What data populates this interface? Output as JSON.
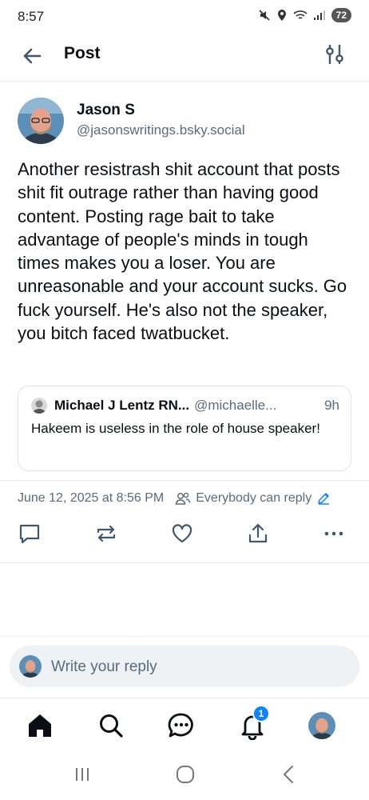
{
  "status_bar": {
    "time": "8:57",
    "battery": "72"
  },
  "header": {
    "title": "Post"
  },
  "post": {
    "author": {
      "name": "Jason S",
      "handle": "@jasonswritings.bsky.social"
    },
    "text": "Another resistrash shit account that posts shit fit outrage rather than having good content. Posting rage bait to take advantage of people's minds in tough times makes you a loser. You are unreasonable and your account sucks. Go fuck yourself. He's also not the speaker, you bitch faced twatbucket.",
    "quote": {
      "author_name": "Michael J Lentz RN...",
      "author_handle": "@michaelle...",
      "time": "9h",
      "text": "Hakeem is useless in the role of house speaker!"
    },
    "timestamp": "June 12, 2025 at 8:56 PM",
    "reply_setting": "Everybody can reply"
  },
  "actions": {
    "reply_icon": "comment-icon",
    "repost_icon": "repost-icon",
    "like_icon": "heart-icon",
    "share_icon": "share-icon",
    "more_icon": "more-icon"
  },
  "reply_bar": {
    "placeholder": "Write your reply"
  },
  "bottom_nav": {
    "items": [
      "home-icon",
      "search-icon",
      "chat-icon",
      "bell-icon",
      "profile-avatar"
    ],
    "notification_count": "1"
  },
  "colors": {
    "accent": "#1083fe",
    "icon": "#42576c",
    "muted_text": "#5a6b7d",
    "reply_bar_bg": "#eef2f5"
  }
}
